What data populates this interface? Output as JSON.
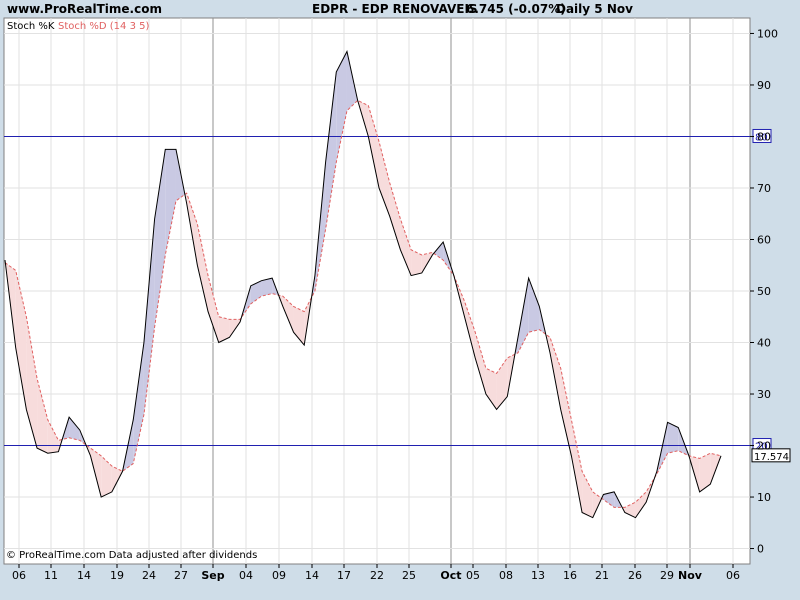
{
  "header": {
    "site": "www.ProRealTime.com",
    "title": "EDPR - EDP RENOVAVEIS",
    "price": "6.745 (-0.07%)",
    "period": "Daily  5 Nov"
  },
  "footer": {
    "copyright": "© ProRealTime.com  Data adjusted after dividends"
  },
  "colors": {
    "background": "#cfdde8",
    "plot": "#ffffff",
    "grid": "#e2e2e2",
    "k_line": "#000000",
    "d_line": "#e06060",
    "fill_k_above": "#c9c9e3",
    "fill_d_above": "#f7dcdc",
    "level_line": "#2020b0",
    "month_line": "#909090"
  },
  "chart_data": {
    "type": "line",
    "series": [
      {
        "name": "Stoch %K",
        "values": [
          56,
          39,
          27,
          19.5,
          18.5,
          18.8,
          25.5,
          23,
          18,
          10,
          11,
          15,
          25,
          40,
          64,
          77.5,
          77.5,
          67,
          55,
          46,
          40,
          41,
          44,
          51,
          52,
          52.5,
          47,
          42,
          39.5,
          53,
          75,
          92.5,
          96.5,
          87,
          80,
          70,
          64.5,
          58,
          53,
          53.5,
          57,
          59.5,
          53,
          45,
          37,
          30,
          27,
          29.5,
          41,
          52.5,
          47,
          38,
          27,
          18,
          7,
          6,
          10.5,
          11,
          7,
          6,
          9,
          15,
          24.5,
          23.5,
          18,
          11,
          12.5,
          18
        ]
      },
      {
        "name": "Stoch %D (14 3 5)",
        "values": [
          55.5,
          54,
          45,
          33,
          25,
          21,
          21.5,
          21,
          19.5,
          18,
          16,
          15,
          16.5,
          26,
          43,
          57,
          67.5,
          69,
          63,
          53,
          45,
          44.5,
          44.5,
          47.5,
          49,
          49.5,
          49,
          47,
          46,
          50,
          62,
          75,
          85,
          87,
          86,
          79,
          71,
          64,
          58,
          57,
          57.5,
          56,
          53,
          48,
          42,
          35,
          34,
          37,
          38,
          42,
          42.5,
          41,
          35,
          25,
          15,
          11,
          9.5,
          8,
          8,
          9,
          11,
          14.5,
          18.5,
          19,
          18,
          17.5,
          18.5,
          18
        ]
      }
    ],
    "x_tick_labels": [
      "06",
      "11",
      "14",
      "19",
      "24",
      "27",
      "Sep",
      "04",
      "09",
      "14",
      "17",
      "22",
      "25",
      "Oct",
      "05",
      "08",
      "13",
      "16",
      "21",
      "26",
      "29",
      "Nov",
      "06"
    ],
    "bold_ticks": [
      "Sep",
      "Oct",
      "Nov"
    ],
    "y_ticks": [
      0,
      10,
      20,
      30,
      40,
      50,
      60,
      70,
      80,
      90,
      100
    ],
    "ylim": [
      -3,
      103
    ],
    "levels": [
      "80",
      "20"
    ],
    "last_value": "17.574",
    "grid": true
  }
}
